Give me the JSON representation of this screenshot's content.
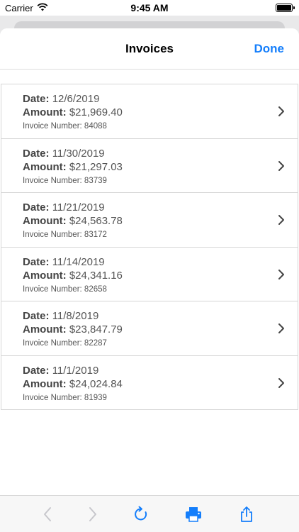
{
  "status_bar": {
    "carrier": "Carrier",
    "time": "9:45 AM"
  },
  "nav": {
    "title": "Invoices",
    "done_label": "Done"
  },
  "invoices": [
    {
      "date_label": "Date:",
      "date": "12/6/2019",
      "amount_label": "Amount:",
      "amount": "$21,969.40",
      "number_text": "Invoice Number: 84088"
    },
    {
      "date_label": "Date:",
      "date": "11/30/2019",
      "amount_label": "Amount:",
      "amount": "$21,297.03",
      "number_text": "Invoice Number: 83739"
    },
    {
      "date_label": "Date:",
      "date": "11/21/2019",
      "amount_label": "Amount:",
      "amount": "$24,563.78",
      "number_text": "Invoice Number: 83172"
    },
    {
      "date_label": "Date:",
      "date": "11/14/2019",
      "amount_label": "Amount:",
      "amount": "$24,341.16",
      "number_text": "Invoice Number: 82658"
    },
    {
      "date_label": "Date:",
      "date": "11/8/2019",
      "amount_label": "Amount:",
      "amount": "$23,847.79",
      "number_text": "Invoice Number: 82287"
    },
    {
      "date_label": "Date:",
      "date": "11/1/2019",
      "amount_label": "Amount:",
      "amount": "$24,024.84",
      "number_text": "Invoice Number: 81939"
    }
  ],
  "toolbar": {
    "icons": [
      "back-icon",
      "forward-icon",
      "reload-icon",
      "print-icon",
      "share-icon"
    ]
  },
  "colors": {
    "accent": "#147efb",
    "disabled": "#c7c7cc"
  }
}
